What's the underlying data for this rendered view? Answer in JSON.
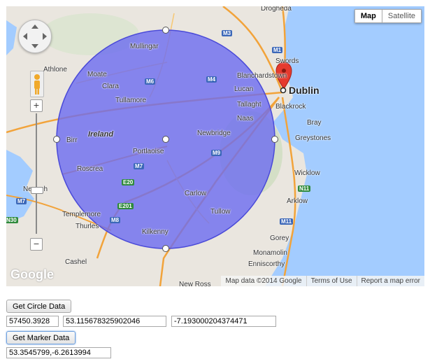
{
  "map": {
    "type_buttons": [
      {
        "label": "Map"
      },
      {
        "label": "Satellite"
      }
    ],
    "labels": {
      "drogheda": "Drogheda",
      "mullingar": "Mullingar",
      "athlone": "Athlone",
      "moate": "Moate",
      "clara": "Clara",
      "tullamore": "Tullamore",
      "ireland": "Ireland",
      "birr": "Birr",
      "portlaoise": "Portlaoise",
      "roscrea": "Roscrea",
      "nenagh": "Nenagh",
      "templemore": "Templemore",
      "thurles": "Thurles",
      "cashel": "Cashel",
      "kilkenny": "Kilkenny",
      "carlow": "Carlow",
      "tullow": "Tullow",
      "newbridge": "Newbridge",
      "naas": "Naas",
      "tallaght": "Tallaght",
      "lucan": "Lucan",
      "blanchardstown": "Blanchardstown",
      "swords": "Swords",
      "dublin": "Dublin",
      "blackrock": "Blackrock",
      "bray": "Bray",
      "greystones": "Greystones",
      "wicklow": "Wicklow",
      "arklow": "Arklow",
      "gorey": "Gorey",
      "monamolin": "Monamolin",
      "enniscorthy": "Enniscorthy",
      "new_ross": "New Ross"
    },
    "shields": {
      "m1": "M1",
      "m3": "M3",
      "m4": "M4",
      "m6": "M6",
      "m7": "M7",
      "m7b": "M7",
      "m8": "M8",
      "m9": "M9",
      "m11": "M11",
      "e20": "E20",
      "e201": "E201",
      "n11": "N11",
      "n30": "N30"
    },
    "footer": {
      "attribution": "Map data ©2014 Google",
      "terms": "Terms of Use",
      "report": "Report a map error"
    },
    "google_logo": "Google",
    "colors": {
      "circle_fill": "#6b6bf0",
      "circle_stroke": "#4a4ad8",
      "sea": "#a3ccff",
      "land": "#eae6df",
      "marker": "#e53a2e"
    }
  },
  "controls": {
    "circle_button": "Get Circle Data",
    "radius_value": "57450.3928",
    "lat_value": "53.115678325902046",
    "lng_value": "-7.193000204374471",
    "marker_button": "Get Marker Data",
    "marker_value": "53.3545799,-6.2613994"
  },
  "icons": {
    "pan": "pan-control-icon",
    "pegman": "pegman-icon",
    "zoom_in": "zoom-in-icon",
    "zoom_out": "zoom-out-icon",
    "marker": "map-marker-icon"
  }
}
